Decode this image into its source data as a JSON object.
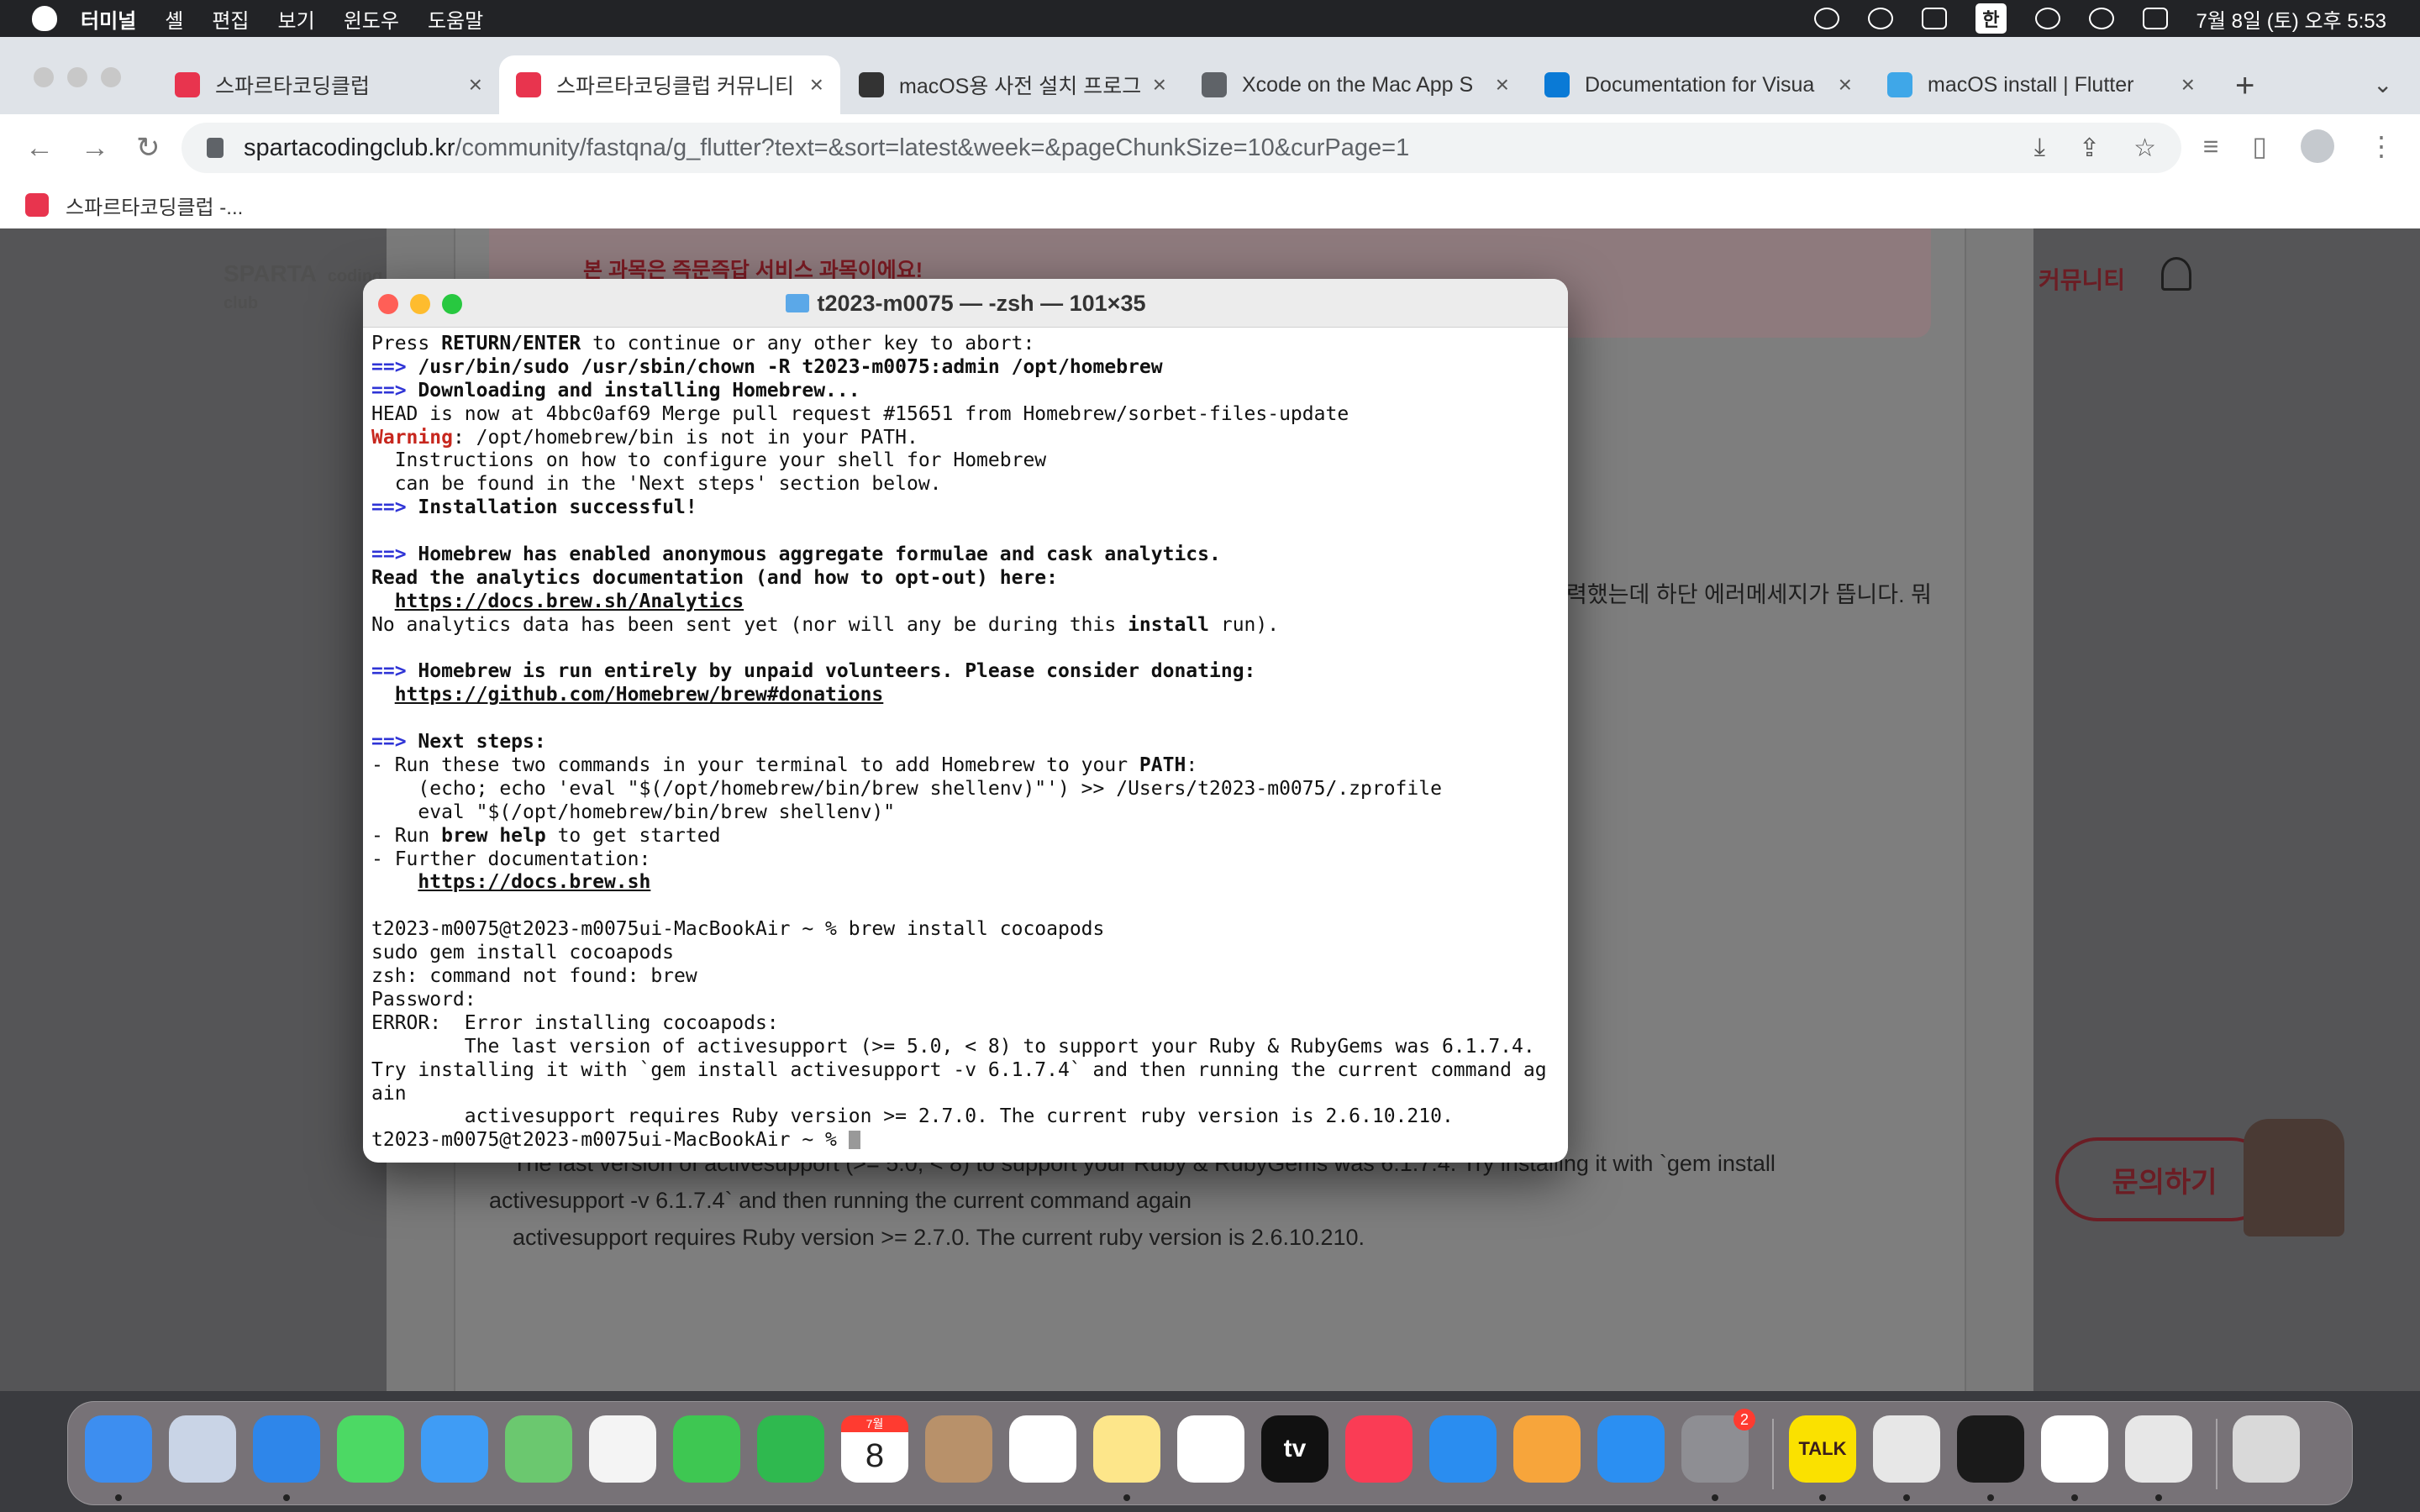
{
  "menubar": {
    "items": [
      "터미널",
      "셸",
      "편집",
      "보기",
      "윈도우",
      "도움말"
    ],
    "han_label": "한",
    "datetime": "7월 8일 (토) 오후 5:53"
  },
  "tabs": [
    {
      "title": "스파르타코딩클럽",
      "icon": "sparta-favicon",
      "color": "#e8344e"
    },
    {
      "title": "스파르타코딩클럽 커뮤니티 |",
      "icon": "sparta-favicon",
      "color": "#e8344e"
    },
    {
      "title": "macOS용 사전 설치 프로그램",
      "icon": "laptop-favicon",
      "color": "#333333"
    },
    {
      "title": "Xcode on the Mac App S",
      "icon": "globe-favicon",
      "color": "#5f6368"
    },
    {
      "title": "Documentation for Visua",
      "icon": "vscode-favicon",
      "color": "#0a7ad6"
    },
    {
      "title": "macOS install | Flutter",
      "icon": "flutter-favicon",
      "color": "#3fa7e8"
    }
  ],
  "address": {
    "host": "spartacodingclub.kr",
    "path": "/community/fastqna/g_flutter?text=&sort=latest&week=&pageChunkSize=10&curPage=1"
  },
  "bookmark": {
    "label": "스파르타코딩클럽 -..."
  },
  "site": {
    "logo_line1": "SPARTA",
    "logo_line2": "coding club",
    "notice": "본 과목은 즉문즉답 서비스 과목이에요!",
    "community": "커뮤니티",
    "partial_text": "력했는데 하단 에러메세지가 뜹니다. 뭐",
    "error_line1": "The last version of activesupport (>= 5.0, < 8) to support your Ruby & RubyGems was 6.1.7.4. Try installing it with `gem install",
    "error_line2": "activesupport -v 6.1.7.4` and then running the current command again",
    "error_line3": "activesupport requires Ruby version >= 2.7.0. The current ruby version is 2.6.10.210.",
    "ask_button": "문의하기"
  },
  "terminal": {
    "title": "t2023-m0075 — -zsh — 101×35",
    "lines": [
      [
        {
          "t": "Press "
        },
        {
          "t": "RETURN/ENTER",
          "s": "b"
        },
        {
          "t": " to continue or any other key to abort:"
        }
      ],
      [
        {
          "t": "==>",
          "s": "arrow"
        },
        {
          "t": " /usr/bin/sudo /usr/sbin/chown -R t2023-m0075:admin /opt/homebrew",
          "s": "b"
        }
      ],
      [
        {
          "t": "==>",
          "s": "arrow"
        },
        {
          "t": " Downloading and installing Homebrew...",
          "s": "b"
        }
      ],
      [
        {
          "t": "HEAD is now at 4bbc0af69 Merge pull request #15651 from Homebrew/sorbet-files-update"
        }
      ],
      [
        {
          "t": "Warning",
          "s": "warn"
        },
        {
          "t": ": /opt/homebrew/bin is not in your PATH."
        }
      ],
      [
        {
          "t": "  Instructions on how to configure your shell for Homebrew"
        }
      ],
      [
        {
          "t": "  can be found in the 'Next steps' section below."
        }
      ],
      [
        {
          "t": "==>",
          "s": "arrow"
        },
        {
          "t": " Installation successful!",
          "s": "b"
        }
      ],
      [
        {
          "t": ""
        }
      ],
      [
        {
          "t": "==>",
          "s": "arrow"
        },
        {
          "t": " Homebrew has enabled anonymous aggregate formulae and cask analytics.",
          "s": "b"
        }
      ],
      [
        {
          "t": "Read the analytics documentation (and how to opt-out) here:",
          "s": "b"
        }
      ],
      [
        {
          "t": "  "
        },
        {
          "t": "https://docs.brew.sh/Analytics",
          "s": "u"
        }
      ],
      [
        {
          "t": "No analytics data has been sent yet (nor will any be during this "
        },
        {
          "t": "install",
          "s": "b"
        },
        {
          "t": " run)."
        }
      ],
      [
        {
          "t": ""
        }
      ],
      [
        {
          "t": "==>",
          "s": "arrow"
        },
        {
          "t": " Homebrew is run entirely by unpaid volunteers. Please consider donating:",
          "s": "b"
        }
      ],
      [
        {
          "t": "  "
        },
        {
          "t": "https://github.com/Homebrew/brew#donations",
          "s": "u"
        }
      ],
      [
        {
          "t": ""
        }
      ],
      [
        {
          "t": "==>",
          "s": "arrow"
        },
        {
          "t": " Next steps:",
          "s": "b"
        }
      ],
      [
        {
          "t": "- Run these two commands in your terminal to add Homebrew to your "
        },
        {
          "t": "PATH",
          "s": "b"
        },
        {
          "t": ":"
        }
      ],
      [
        {
          "t": "    (echo; echo 'eval \"$(/opt/homebrew/bin/brew shellenv)\"') >> /Users/t2023-m0075/.zprofile"
        }
      ],
      [
        {
          "t": "    eval \"$(/opt/homebrew/bin/brew shellenv)\""
        }
      ],
      [
        {
          "t": "- Run "
        },
        {
          "t": "brew help",
          "s": "b"
        },
        {
          "t": " to get started"
        }
      ],
      [
        {
          "t": "- Further documentation:"
        }
      ],
      [
        {
          "t": "    "
        },
        {
          "t": "https://docs.brew.sh",
          "s": "u"
        }
      ],
      [
        {
          "t": ""
        }
      ],
      [
        {
          "t": "t2023-m0075@t2023-m0075ui-MacBookAir ~ % brew install cocoapods"
        }
      ],
      [
        {
          "t": "sudo gem install cocoapods"
        }
      ],
      [
        {
          "t": "zsh: command not found: brew"
        }
      ],
      [
        {
          "t": "Password:"
        }
      ],
      [
        {
          "t": "ERROR:  Error installing cocoapods:"
        }
      ],
      [
        {
          "t": "        The last version of activesupport (>= 5.0, < 8) to support your Ruby & RubyGems was 6.1.7.4."
        }
      ],
      [
        {
          "t": "Try installing it with `gem install activesupport -v 6.1.7.4` and then running the current command ag"
        }
      ],
      [
        {
          "t": "ain"
        }
      ],
      [
        {
          "t": "        activesupport requires Ruby version >= 2.7.0. The current ruby version is 2.6.10.210."
        }
      ],
      [
        {
          "t": "t2023-m0075@t2023-m0075ui-MacBookAir ~ % "
        }
      ]
    ]
  },
  "dock": {
    "apps": [
      {
        "name": "finder",
        "color": "#3d8ef0",
        "running": true
      },
      {
        "name": "launchpad",
        "color": "#c9d4e6",
        "running": false
      },
      {
        "name": "safari",
        "color": "#2e86ea",
        "running": true
      },
      {
        "name": "messages",
        "color": "#4cd964",
        "running": false
      },
      {
        "name": "mail",
        "color": "#3f9cf5",
        "running": false
      },
      {
        "name": "maps",
        "color": "#6bc86f",
        "running": false
      },
      {
        "name": "photos",
        "color": "#f4f4f4",
        "running": false
      },
      {
        "name": "facetime",
        "color": "#3ec752",
        "running": false
      },
      {
        "name": "numbers",
        "color": "#2fb94f",
        "running": false
      },
      {
        "name": "calendar",
        "color": "#ffffff",
        "running": false,
        "label_month": "7월",
        "label_day": "8"
      },
      {
        "name": "contacts",
        "color": "#b8916a",
        "running": false
      },
      {
        "name": "reminders",
        "color": "#ffffff",
        "running": false
      },
      {
        "name": "notes",
        "color": "#fde68a",
        "running": true
      },
      {
        "name": "freeform",
        "color": "#ffffff",
        "running": false
      },
      {
        "name": "apple-tv",
        "color": "#111111",
        "running": false,
        "label": "tv"
      },
      {
        "name": "music",
        "color": "#fa3c55",
        "running": false
      },
      {
        "name": "keynote",
        "color": "#2a8df0",
        "running": false
      },
      {
        "name": "pages",
        "color": "#f7a53b",
        "running": false
      },
      {
        "name": "app-store",
        "color": "#2b8ff2",
        "running": false
      },
      {
        "name": "system-settings",
        "color": "#8e8e93",
        "running": true,
        "badge": "2"
      },
      {
        "name": "kakaotalk",
        "color": "#fae100",
        "running": true,
        "label": "TALK"
      },
      {
        "name": "chrome",
        "color": "#e7e7e7",
        "running": true
      },
      {
        "name": "terminal",
        "color": "#1a1a1a",
        "running": true
      },
      {
        "name": "vscode",
        "color": "#ffffff",
        "running": true
      },
      {
        "name": "chrome-alt",
        "color": "#e7e7e7",
        "running": true
      },
      {
        "name": "trash",
        "color": "#d9d9d9",
        "running": false
      }
    ]
  }
}
